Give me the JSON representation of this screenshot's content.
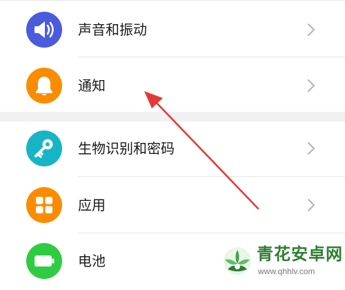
{
  "settings": {
    "items": [
      {
        "label": "声音和振动",
        "icon": "volume-icon",
        "color": "#4a5bdc"
      },
      {
        "label": "通知",
        "icon": "bell-icon",
        "color": "#fb8c00"
      },
      {
        "label": "生物识别和密码",
        "icon": "key-icon",
        "color": "#16b5c5"
      },
      {
        "label": "应用",
        "icon": "apps-grid-icon",
        "color": "#fb8c00"
      },
      {
        "label": "电池",
        "icon": "battery-icon",
        "color": "#2ecc40"
      }
    ]
  },
  "annotation": {
    "arrow_color": "#e53935"
  },
  "watermark": {
    "title": "青花安卓网",
    "url": "www.qhhlv.com"
  }
}
